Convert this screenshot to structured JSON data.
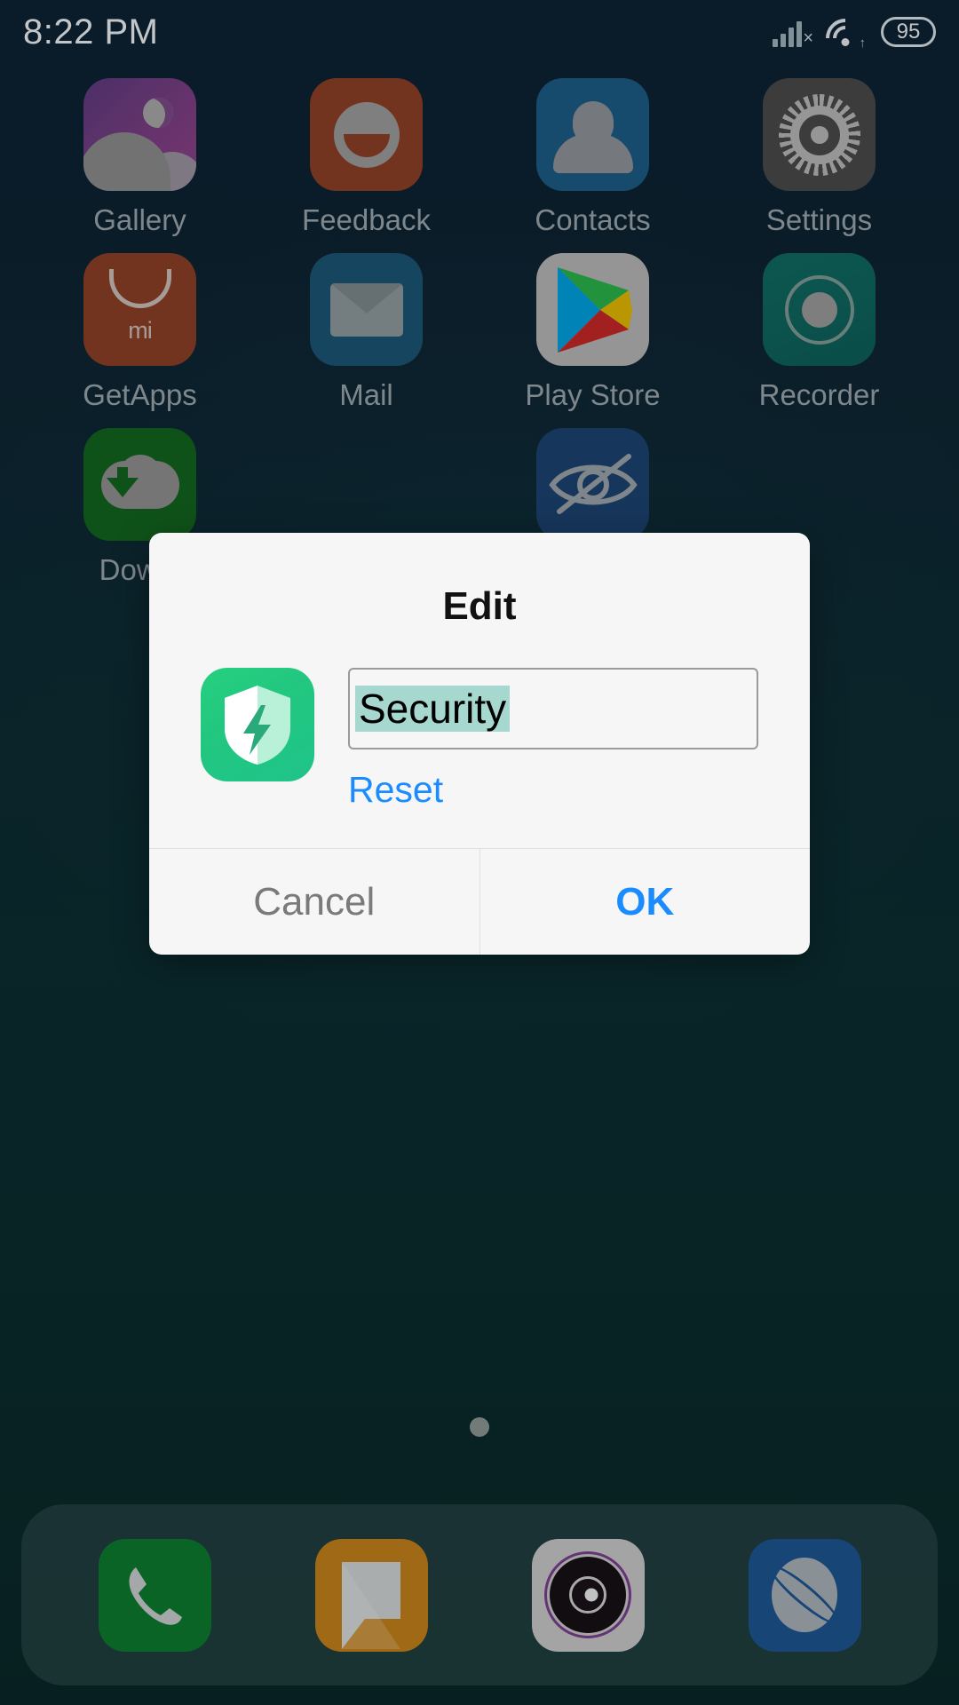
{
  "status_bar": {
    "time": "8:22 PM",
    "battery_level": "95",
    "signal_icon": "signal-no-sim-icon",
    "wifi_icon": "wifi-icon",
    "battery_icon": "battery-icon"
  },
  "home_screen": {
    "apps": [
      {
        "label": "Gallery",
        "icon": "gallery-icon"
      },
      {
        "label": "Feedback",
        "icon": "feedback-icon"
      },
      {
        "label": "Contacts",
        "icon": "contacts-icon"
      },
      {
        "label": "Settings",
        "icon": "settings-icon"
      },
      {
        "label": "GetApps",
        "icon": "getapps-icon"
      },
      {
        "label": "Mail",
        "icon": "mail-icon"
      },
      {
        "label": "Play Store",
        "icon": "play-store-icon"
      },
      {
        "label": "Recorder",
        "icon": "recorder-icon"
      },
      {
        "label": "Downl",
        "icon": "downloads-icon"
      },
      {
        "label": "",
        "icon": ""
      },
      {
        "label": "",
        "icon": "eye-slash-icon"
      },
      {
        "label": "",
        "icon": ""
      }
    ],
    "getapps_brand_text": "mi",
    "page_indicator": {
      "pages": 1,
      "current": 1
    }
  },
  "dock": {
    "items": [
      {
        "name": "phone",
        "icon": "phone-icon"
      },
      {
        "name": "messages",
        "icon": "message-icon"
      },
      {
        "name": "camera",
        "icon": "camera-icon"
      },
      {
        "name": "browser",
        "icon": "browser-globe-icon"
      }
    ]
  },
  "dialog": {
    "title": "Edit",
    "app_icon": "security-shield-icon",
    "input_value": "Security",
    "input_placeholder": "",
    "reset_label": "Reset",
    "cancel_label": "Cancel",
    "ok_label": "OK"
  },
  "colors": {
    "accent_blue": "#1a8cff",
    "selection_highlight": "#a6d8cf",
    "dialog_background": "#f6f6f6",
    "wallpaper_top": "#0d2133",
    "wallpaper_bottom": "#092728",
    "security_green": "#22c77f"
  }
}
